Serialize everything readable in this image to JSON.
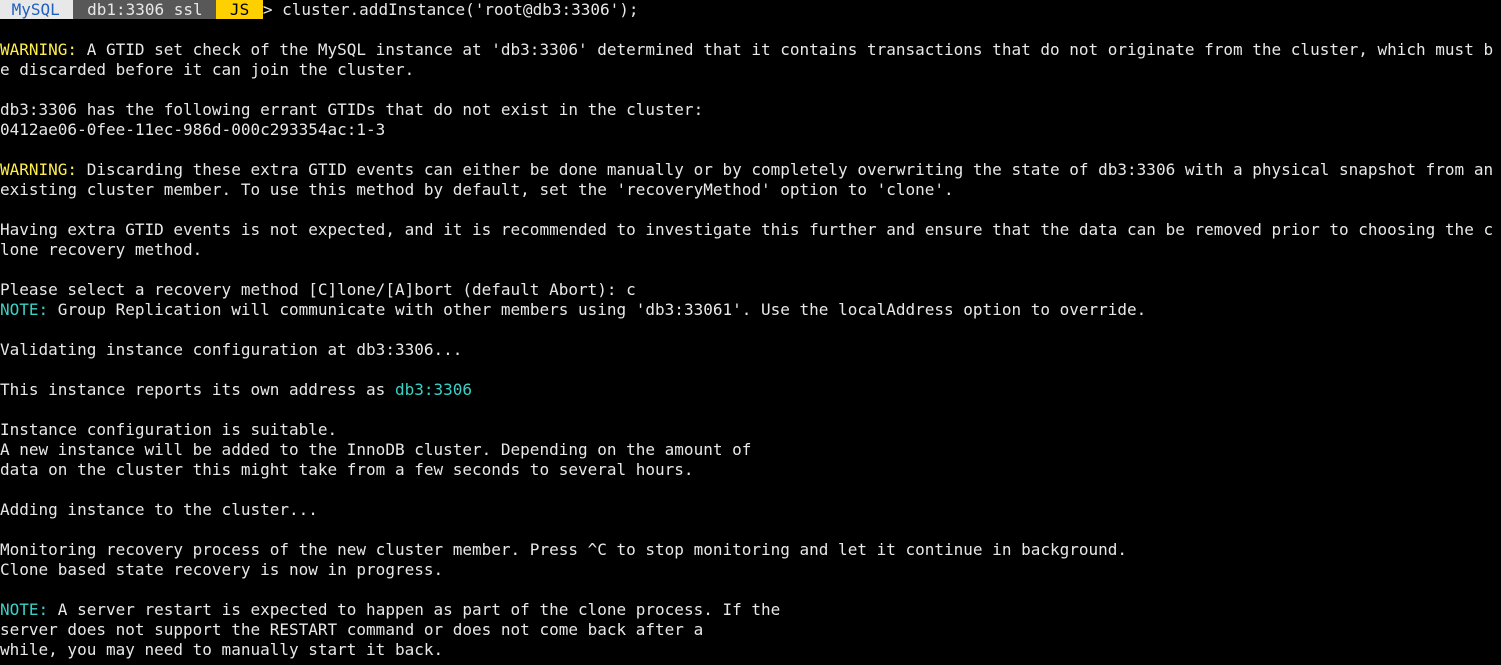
{
  "prompt": {
    "mysql": " MySQL ",
    "host": " db1:3306 ssl ",
    "mode": " JS ",
    "arrow": ">",
    "command": "cluster.addInstance('root@db3:3306');"
  },
  "lines": {
    "w1_label": "WARNING:",
    "w1_text": " A GTID set check of the MySQL instance at 'db3:3306' determined that it contains transactions that do not originate from the cluster, which must be discarded before it can join the cluster.",
    "errant_intro": "db3:3306 has the following errant GTIDs that do not exist in the cluster:",
    "errant_gtid": "0412ae06-0fee-11ec-986d-000c293354ac:1-3",
    "w2_label": "WARNING:",
    "w2_text": " Discarding these extra GTID events can either be done manually or by completely overwriting the state of db3:3306 with a physical snapshot from an existing cluster member. To use this method by default, set the 'recoveryMethod' option to 'clone'.",
    "extra_gtid": "Having extra GTID events is not expected, and it is recommended to investigate this further and ensure that the data can be removed prior to choosing the clone recovery method.",
    "select_prompt": "Please select a recovery method [C]lone/[A]bort (default Abort): c",
    "note1_label": "NOTE:",
    "note1_text": " Group Replication will communicate with other members using 'db3:33061'. Use the localAddress option to override.",
    "validating": "Validating instance configuration at db3:3306...",
    "report_pre": "This instance reports its own address as ",
    "report_addr": "db3:3306",
    "suitable": "Instance configuration is suitable.",
    "newinst1": "A new instance will be added to the InnoDB cluster. Depending on the amount of",
    "newinst2": "data on the cluster this might take from a few seconds to several hours.",
    "adding": "Adding instance to the cluster...",
    "monitor": "Monitoring recovery process of the new cluster member. Press ^C to stop monitoring and let it continue in background.",
    "clone_state": "Clone based state recovery is now in progress.",
    "note2_label": "NOTE:",
    "note2_text": " A server restart is expected to happen as part of the clone process. If the",
    "restart2": "server does not support the RESTART command or does not come back after a",
    "restart3": "while, you may need to manually start it back."
  }
}
